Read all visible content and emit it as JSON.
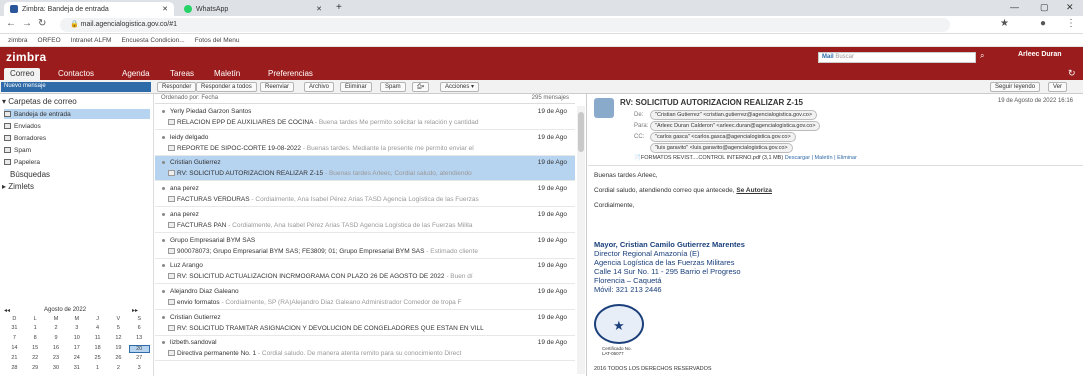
{
  "browser": {
    "tabs": [
      {
        "label": "Zimbra: Bandeja de entrada"
      },
      {
        "label": "WhatsApp"
      }
    ],
    "url": "mail.agencialogistica.gov.co/#1",
    "bookmarks": [
      "zimbra",
      "ORFEO",
      "Intranet ALFM",
      "Encuesta Condicion...",
      "Fotos del Menu"
    ]
  },
  "header": {
    "logo": "zimbra",
    "search_scope": "Mail",
    "search_placeholder": "Buscar",
    "user": "Arleec Duran"
  },
  "apptabs": [
    "Correo",
    "Contactos",
    "Agenda",
    "Tareas",
    "Maletín",
    "Preferencias"
  ],
  "toolbar": {
    "new": "Nuevo mensaje",
    "buttons": [
      "Responder",
      "Responder a todos",
      "Reenviar",
      "Archivo",
      "Eliminar",
      "Spam",
      "Acciones"
    ],
    "reading": "Seguir leyendo",
    "view": "Ver"
  },
  "sidebar": {
    "section": "Carpetas de correo",
    "folders": [
      "Bandeja de entrada",
      "Enviados",
      "Borradores",
      "Spam",
      "Papelera"
    ],
    "search": "Búsquedas",
    "zimlets": "Zimlets"
  },
  "calendar": {
    "title": "Agosto de 2022",
    "dow": [
      "D",
      "L",
      "M",
      "M",
      "J",
      "V",
      "S"
    ],
    "weeks": [
      [
        "31",
        "1",
        "2",
        "3",
        "4",
        "5",
        "6"
      ],
      [
        "7",
        "8",
        "9",
        "10",
        "11",
        "12",
        "13"
      ],
      [
        "14",
        "15",
        "16",
        "17",
        "18",
        "19",
        "20"
      ],
      [
        "21",
        "22",
        "23",
        "24",
        "25",
        "26",
        "27"
      ],
      [
        "28",
        "29",
        "30",
        "31",
        "1",
        "2",
        "3"
      ]
    ],
    "today": "20"
  },
  "list": {
    "sort": "Ordenado por: Fecha",
    "count": "295 mensajes",
    "messages": [
      {
        "from": "Yerly Piedad Garzon Santos",
        "date": "19 de Ago",
        "subject": "RELACION EPP DE AUXILIARES DE COCINA",
        "frag": " - Buena tardes Me permito solicitar la relación y cantidad"
      },
      {
        "from": "leidy delgado",
        "date": "19 de Ago",
        "subject": "REPORTE DE SIPOC-CORTE 19-08-2022",
        "frag": " - Buenas tardes. Mediante la presente me permito enviar el"
      },
      {
        "from": "Cristian Gutierrez",
        "date": "19 de Ago",
        "subject": "RV: SOLICITUD AUTORIZACION REALIZAR Z-15",
        "frag": " - Buenas tardes Arleec, Cordial saludo, atendiendo"
      },
      {
        "from": "ana perez",
        "date": "19 de Ago",
        "subject": "FACTURAS VERDURAS",
        "frag": " - Cordialmente, Ana Isabel Pérez Arias TASD Agencia Logística de las Fuerzas"
      },
      {
        "from": "ana perez",
        "date": "19 de Ago",
        "subject": "FACTURAS PAN",
        "frag": " - Cordialmente, Ana Isabel Pérez Arias TASD Agencia Logística de las Fuerzas Milita"
      },
      {
        "from": "Grupo Empresarial BYM SAS",
        "date": "19 de Ago",
        "subject": "900078073; Grupo Empresarial BYM SAS; FE3809; 01; Grupo Empresarial BYM SAS",
        "frag": " - Estimado cliente"
      },
      {
        "from": "Luz Arango",
        "date": "19 de Ago",
        "subject": "RV: SOLICITUD ACTUALIZACION INCRMOGRAMA CON PLAZO 26 DE AGOSTO DE 2022",
        "frag": " - Buen dí"
      },
      {
        "from": "Alejandro Diaz Galeano",
        "date": "19 de Ago",
        "subject": "envio formatos",
        "frag": " - Cordialmente, SP (RA)Alejandro Diaz Galeano Administrador Comedor de tropa F"
      },
      {
        "from": "Cristian Gutierrez",
        "date": "19 de Ago",
        "subject": "RV: SOLICITUD TRAMITAR ASIGNACION Y DEVOLUCION DE CONGELADORES QUE ESTAN EN VILL",
        "frag": ""
      },
      {
        "from": "lizbeth.sandoval",
        "date": "19 de Ago",
        "subject": "Directiva permanente No. 1",
        "frag": " - Cordial saludo. De manera atenta remito para su conocimiento Direct"
      }
    ]
  },
  "reading": {
    "subject": "RV: SOLICITUD AUTORIZACION REALIZAR Z-15",
    "date": "19 de Agosto de 2022 16:16",
    "de_label": "De:",
    "de": "\"Cristian Gutierrez\" <cristian.gutierrez@agencialogistica.gov.co>",
    "para_label": "Para:",
    "para": "\"Arleec Duran Calderon\" <arleec.duran@agencialogistica.gov.co>",
    "cc_label": "CC:",
    "cc1": "\"carlos gasca\" <carlos.gasca@agencialogistica.gov.co>",
    "cc2": "\"luis garavito\" <luis.garavito@agencialogistica.gov.co>",
    "attachment": "FORMATOS REVIST....CONTROL INTERNO.pdf (3,1 MB)",
    "att_links": "Descargar | Maletín | Eliminar",
    "greeting": "Buenas tardes Arleec,",
    "body_pre": "Cordial saludo, atendiendo correo que antecede, ",
    "body_link": "Se Autoriza",
    "closing": "Cordialmente,",
    "sig": [
      "Mayor, Cristian Camilo Gutierrez Marentes",
      "Director Regional Amazonía (E)",
      "Agencia Logística de las Fuerzas Militares",
      "Calle 14 Sur No. 11 - 295 Barrio el Progreso",
      "Florencia – Caquetá",
      "Móvil: 321 213 2446"
    ],
    "cert": "Certificado No. LAT-06077",
    "footer": "2016 TODOS LOS DERECHOS RESERVADOS"
  }
}
